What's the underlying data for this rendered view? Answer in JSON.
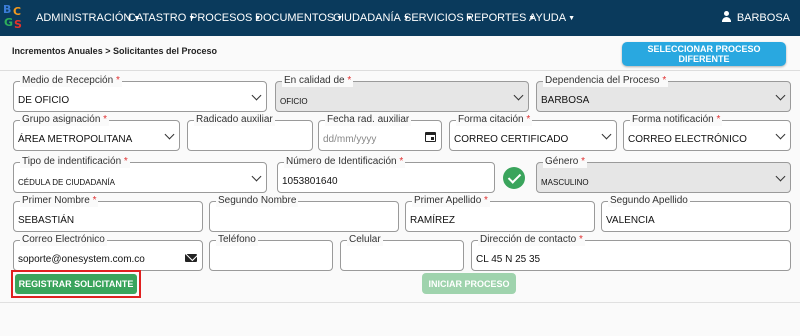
{
  "logo": {
    "letters": [
      "B",
      "C",
      "G",
      "S"
    ],
    "colors": [
      "#3b7dd8",
      "#f29a1f",
      "#2fae5a",
      "#e6332a"
    ]
  },
  "nav": {
    "items": [
      {
        "label": "ADMINISTRACIÓN"
      },
      {
        "label": "CATASTRO"
      },
      {
        "label": "PROCESOS"
      },
      {
        "label": "DOCUMENTOS"
      },
      {
        "label": "CIUDADANÍA"
      },
      {
        "label": "SERVICIOS"
      },
      {
        "label": "REPORTES"
      },
      {
        "label": "AYUDA"
      }
    ],
    "user": "BARBOSA"
  },
  "breadcrumb": "Incrementos Anuales > Solicitantes del Proceso",
  "btn_select_process": "SELECCIONAR PROCESO DIFERENTE",
  "form": {
    "medio_recepcion": {
      "label": "Medio de Recepción",
      "value": "DE OFICIO"
    },
    "en_calidad_de": {
      "label": "En calidad de",
      "value": "OFICIO"
    },
    "dependencia": {
      "label": "Dependencia del Proceso",
      "value": "BARBOSA"
    },
    "grupo_asignacion": {
      "label": "Grupo asignación",
      "value": "ÁREA METROPOLITANA"
    },
    "radicado_auxiliar": {
      "label": "Radicado auxiliar",
      "value": ""
    },
    "fecha_rad_auxiliar": {
      "label": "Fecha rad. auxiliar",
      "placeholder": "dd/mm/yyyy"
    },
    "forma_citacion": {
      "label": "Forma citación",
      "value": "CORREO CERTIFICADO"
    },
    "forma_notificacion": {
      "label": "Forma notificación",
      "value": "CORREO ELECTRÓNICO"
    },
    "tipo_identificacion": {
      "label": "Tipo de indentificación",
      "value": "CÉDULA DE CIUDADANÍA"
    },
    "numero_identificacion": {
      "label": "Número de Identificación",
      "value": "1053801640"
    },
    "genero": {
      "label": "Género",
      "value": "MASCULINO"
    },
    "primer_nombre": {
      "label": "Primer Nombre",
      "value": "SEBASTIÁN"
    },
    "segundo_nombre": {
      "label": "Segundo Nombre",
      "value": ""
    },
    "primer_apellido": {
      "label": "Primer Apellido",
      "value": "RAMÍREZ"
    },
    "segundo_apellido": {
      "label": "Segundo Apellido",
      "value": "VALENCIA"
    },
    "correo": {
      "label": "Correo Electrónico",
      "value": "soporte@onesystem.com.co"
    },
    "telefono": {
      "label": "Teléfono",
      "value": ""
    },
    "celular": {
      "label": "Celular",
      "value": ""
    },
    "direccion": {
      "label": "Dirección de contacto",
      "value": "CL 45 N 25 35"
    },
    "required_mark": "*"
  },
  "btn_registrar": "REGISTRAR SOLICITANTE",
  "btn_iniciar": "INICIAR PROCESO"
}
